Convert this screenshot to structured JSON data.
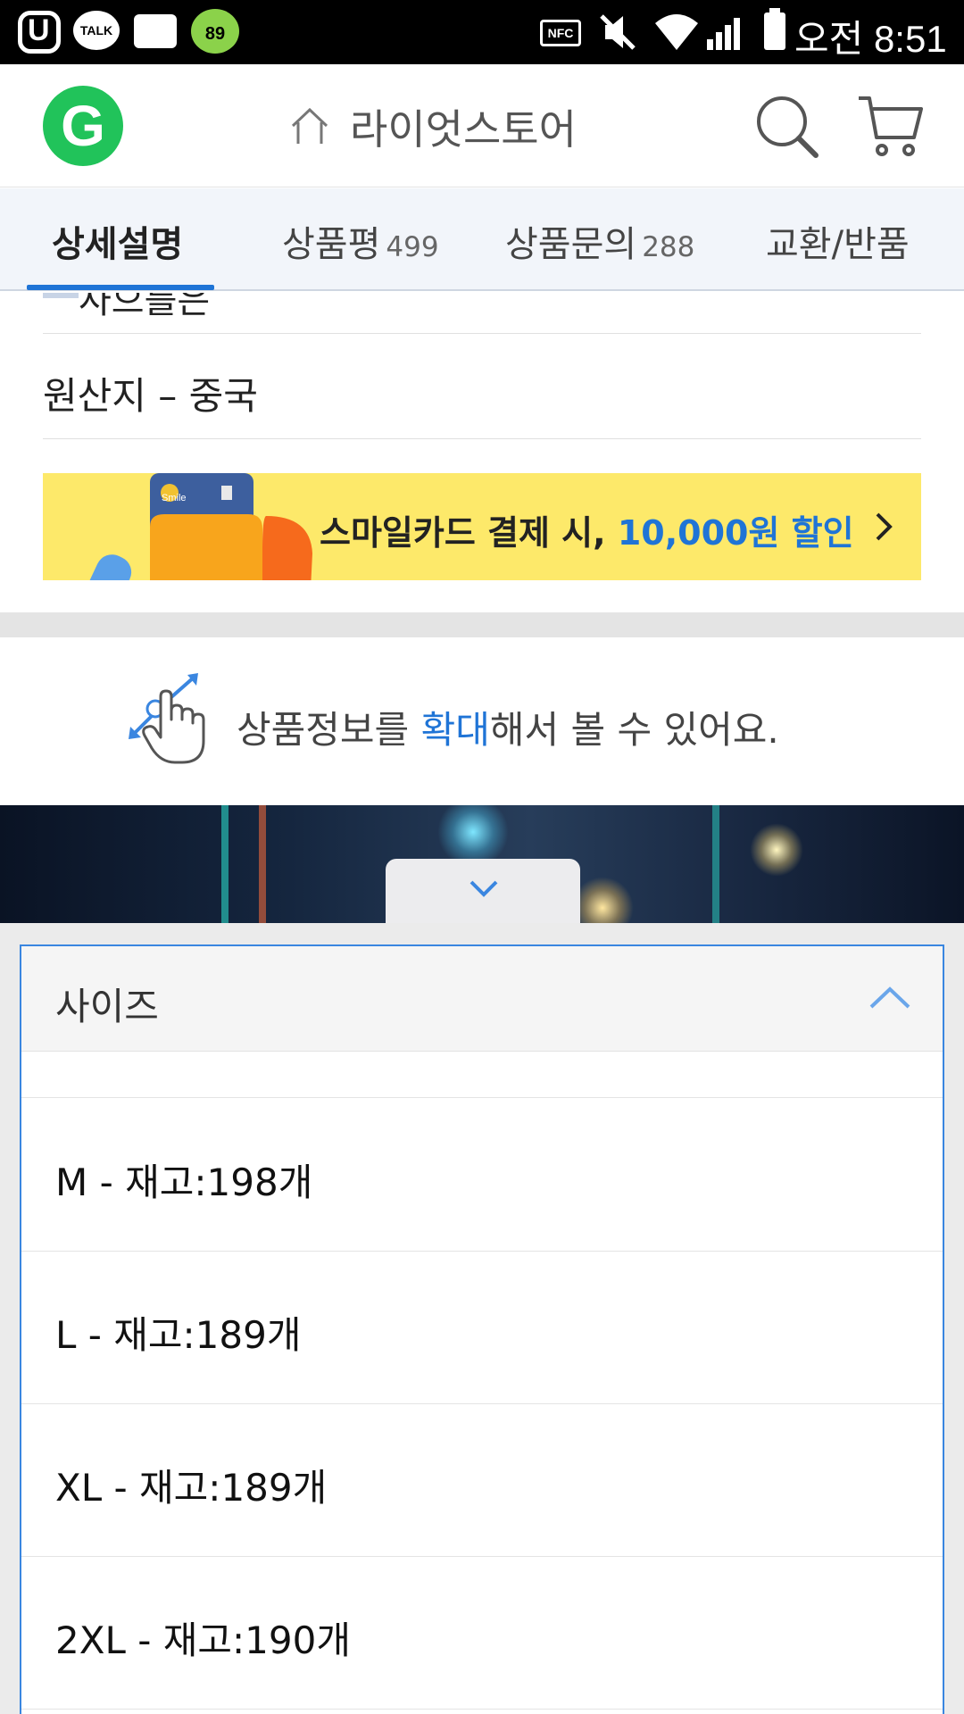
{
  "status_bar": {
    "talk_label": "TALK",
    "paw_badge": "89",
    "nfc_label": "NFC",
    "time": "오전 8:51"
  },
  "header": {
    "logo_letter": "G",
    "store_name": "라이엇스토어"
  },
  "tabs": [
    {
      "label": "상세설명",
      "count": ""
    },
    {
      "label": "상품평",
      "count": "499"
    },
    {
      "label": "상품문의",
      "count": "288"
    },
    {
      "label": "교환/반품",
      "count": ""
    }
  ],
  "spec": {
    "cut_text": "사으를은",
    "origin": "원산지 – 중국"
  },
  "banner": {
    "text_prefix": "스마일카드 결제 시, ",
    "text_highlight": "10,000원 할인",
    "card_logo": "Smile",
    "brand_color": "#fde96a",
    "accent": "#1f74d6"
  },
  "zoom_note": {
    "prefix": "상품정보를 ",
    "highlight": "확대",
    "suffix": "해서 볼 수 있어요."
  },
  "options": {
    "label": "사이즈",
    "items": [
      "M - 재고:198개",
      "L - 재고:189개",
      "XL - 재고:189개",
      "2XL - 재고:190개"
    ]
  }
}
